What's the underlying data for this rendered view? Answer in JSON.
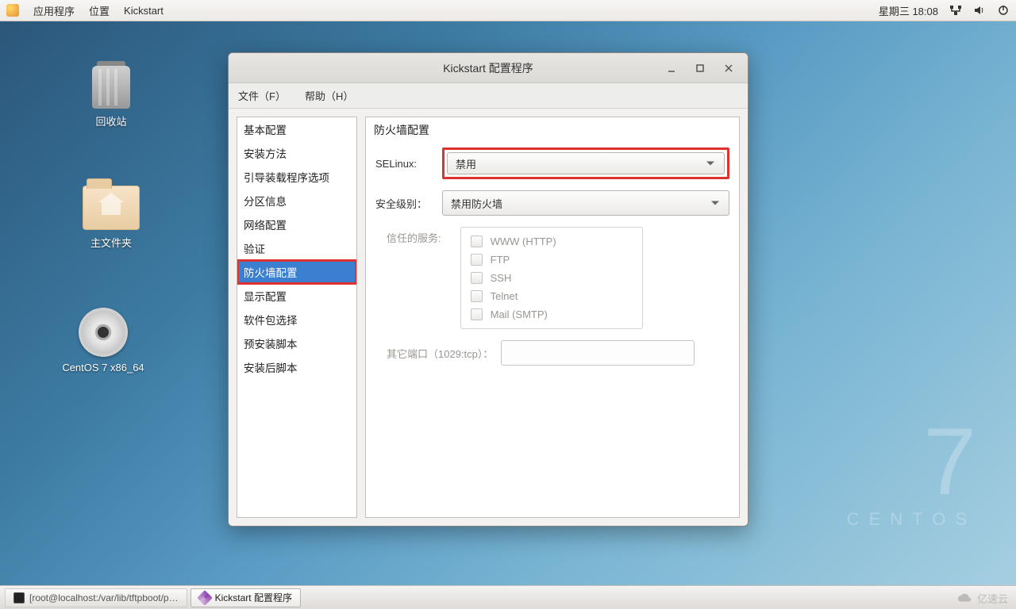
{
  "menubar": {
    "apps": "应用程序",
    "places": "位置",
    "app_name": "Kickstart",
    "datetime": "星期三 18:08"
  },
  "desktop": {
    "trash": "回收站",
    "home": "主文件夹",
    "disc": "CentOS 7 x86_64"
  },
  "watermark": {
    "num": "7",
    "name": "CENTOS"
  },
  "taskbar": {
    "terminal": "[root@localhost:/var/lib/tftpboot/p…",
    "kickstart": "Kickstart 配置程序"
  },
  "brand": "亿速云",
  "window": {
    "title": "Kickstart 配置程序",
    "menu": {
      "file": "文件（F）",
      "help": "帮助（H）"
    },
    "sidebar": [
      "基本配置",
      "安装方法",
      "引导装载程序选项",
      "分区信息",
      "网络配置",
      "验证",
      "防火墙配置",
      "显示配置",
      "软件包选择",
      "预安装脚本",
      "安装后脚本"
    ],
    "selected_index": 6,
    "content": {
      "heading": "防火墙配置",
      "selinux_label": "SELinux:",
      "selinux_value": "禁用",
      "level_label": "安全级别：",
      "level_value": "禁用防火墙",
      "trusted_label": "信任的服务:",
      "services": [
        "WWW (HTTP)",
        "FTP",
        "SSH",
        "Telnet",
        "Mail (SMTP)"
      ],
      "ports_label": "其它端口（1029:tcp）："
    }
  }
}
